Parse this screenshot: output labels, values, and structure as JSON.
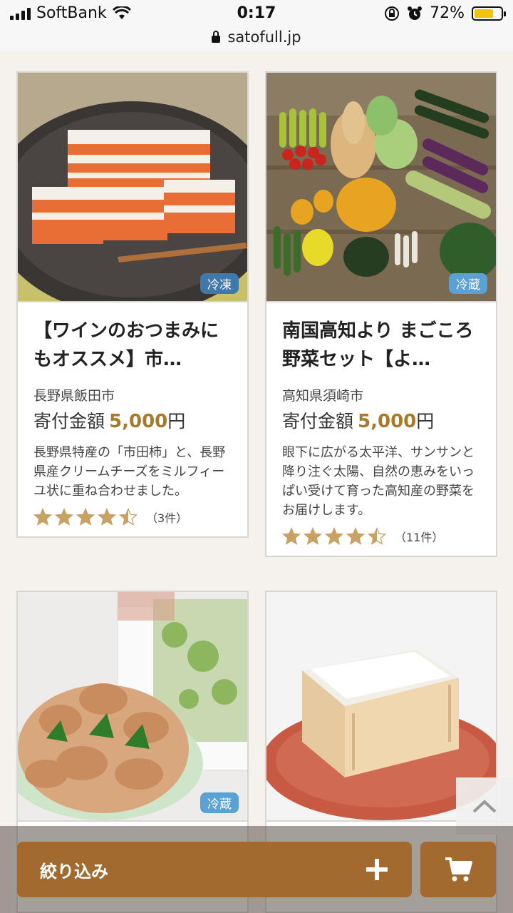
{
  "status_bar": {
    "carrier": "SoftBank",
    "time": "0:17",
    "battery_percent": "72%",
    "battery_level": 0.72,
    "url": "satofull.jp"
  },
  "products": [
    {
      "title": "【ワインのおつまみにもオススメ】市…",
      "storage_tag": "冷凍",
      "region": "長野県飯田市",
      "price_label": "寄付金額",
      "price_value": "5,000",
      "price_unit": "円",
      "description": "長野県特産の「市田柿」と、長野県産クリームチーズをミルフィーユ状に重ね合わせました。",
      "rating": 4.5,
      "review_count": "（3件）"
    },
    {
      "title": "南国高知より まごころ野菜セット【よ…",
      "storage_tag": "冷蔵",
      "region": "高知県須崎市",
      "price_label": "寄付金額",
      "price_value": "5,000",
      "price_unit": "円",
      "description": "眼下に広がる太平洋、サンサンと降り注ぐ太陽、自然の恵みをいっぱい受けて育った高知産の野菜をお届けします。",
      "rating": 4.5,
      "review_count": "（11件）"
    },
    {
      "storage_tag": "冷蔵"
    },
    {}
  ],
  "bottom_bar": {
    "filter_label": "絞り込み",
    "plus_icon": "plus-icon",
    "cart_icon": "cart-icon"
  },
  "colors": {
    "accent": "#a26a2f",
    "price": "#a87a2c",
    "star": "#c8a165",
    "tag_frozen": "#3f78ad",
    "tag_chilled": "#5aa2d6"
  }
}
